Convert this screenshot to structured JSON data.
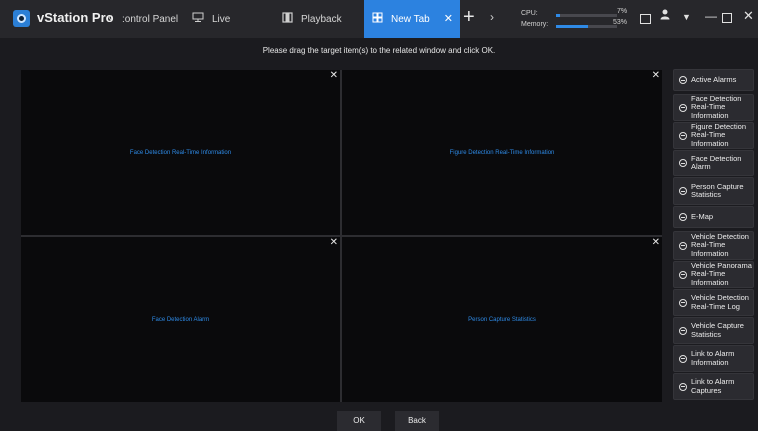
{
  "app": {
    "title": "vStation Pro"
  },
  "tabs": [
    {
      "label": ":ontrol Panel"
    },
    {
      "label": "Live",
      "icon": "monitor-icon"
    },
    {
      "label": "Playback",
      "icon": "film-icon"
    },
    {
      "label": "New Tab",
      "icon": "grid-icon",
      "active": true
    }
  ],
  "nav": {
    "prev": "‹",
    "next": "›",
    "add": "+"
  },
  "stats": {
    "cpu_label": "CPU:",
    "cpu_value": "7%",
    "cpu_fraction": 0.07,
    "memory_label": "Memory:",
    "memory_value": "53%",
    "memory_fraction": 0.53
  },
  "instruction": "Please drag the target item(s) to the related window and click OK.",
  "panes": [
    {
      "label": "Face Detection Real-Time Information"
    },
    {
      "label": "Figure Detection Real-Time Information"
    },
    {
      "label": "Face Detection Alarm"
    },
    {
      "label": "Person Capture Statistics"
    }
  ],
  "side_items": [
    {
      "label": "Active Alarms"
    },
    {
      "label": "Face Detection Real-Time Information"
    },
    {
      "label": "Figure Detection Real-Time Information"
    },
    {
      "label": "Face Detection Alarm"
    },
    {
      "label": "Person Capture Statistics"
    },
    {
      "label": "E-Map"
    },
    {
      "label": "Vehicle Detection Real-Time Information"
    },
    {
      "label": "Vehicle Panorama Real-Time Information"
    },
    {
      "label": "Vehicle Detection Real-Time Log"
    },
    {
      "label": "Vehicle Capture Statistics"
    },
    {
      "label": "Link to Alarm Information"
    },
    {
      "label": "Link to Alarm Captures"
    }
  ],
  "footer": {
    "ok": "OK",
    "back": "Back"
  },
  "colors": {
    "accent": "#2c82e0",
    "pane_label": "#2e8ae6",
    "background": "#1b1b1f"
  }
}
